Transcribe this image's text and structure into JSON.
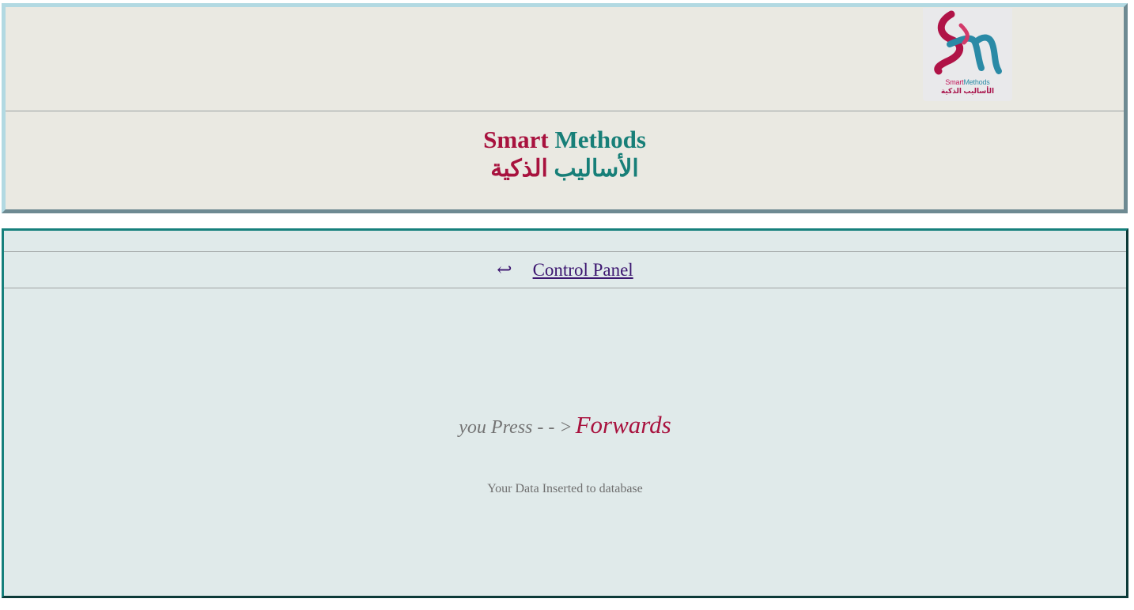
{
  "header": {
    "logo": {
      "icon": "smart-methods-logo",
      "text_en_part1": "Smart",
      "text_en_part2": "Methods",
      "text_ar": "الأساليب الذكية"
    },
    "title_en_word1": "Smart",
    "title_en_word2": "Methods",
    "title_ar_word1": "الأساليب",
    "title_ar_word2": "الذكية"
  },
  "nav": {
    "back_icon": "↩",
    "control_panel_label": "Control Panel"
  },
  "main": {
    "pressed_prefix": "you Press - - >",
    "pressed_action": "Forwards",
    "status_message": "Your Data Inserted to database"
  },
  "colors": {
    "brand_red": "#a8123e",
    "brand_teal": "#177f78",
    "header_bg": "#eae9e2",
    "content_bg": "#e0eaea"
  }
}
